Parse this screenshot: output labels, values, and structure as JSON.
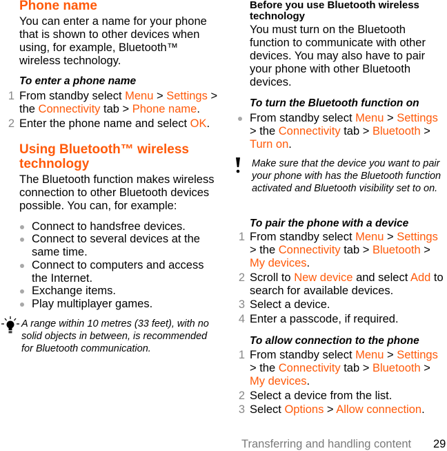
{
  "left": {
    "phone_name": {
      "heading": "Phone name",
      "paragraph": "You can enter a name for your phone that is shown to other devices when using, for example, Bluetooth™ wireless technology.",
      "subheading": "To enter a phone name",
      "steps": [
        {
          "num": "1",
          "parts": [
            "From standby select ",
            "Menu",
            " > ",
            "Settings",
            " > the ",
            "Connectivity",
            " tab > ",
            "Phone name",
            "."
          ]
        },
        {
          "num": "2",
          "parts": [
            "Enter the phone name and select ",
            "OK",
            "."
          ]
        }
      ]
    },
    "bluetooth": {
      "heading": "Using Bluetooth™ wireless technology",
      "paragraph": "The Bluetooth function makes wireless connection to other Bluetooth devices possible. You can, for example:",
      "bullets": [
        "Connect to handsfree devices.",
        "Connect to several devices at the same time.",
        "Connect to computers and access the Internet.",
        "Exchange items.",
        "Play multiplayer games."
      ],
      "tip_icon": "lightbulb-icon",
      "tip": "A range within 10 metres (33 feet), with no solid objects in between, is recommended for Bluetooth communication."
    }
  },
  "right": {
    "before": {
      "heading": "Before you use Bluetooth wireless technology",
      "paragraph": "You must turn on the Bluetooth function to communicate with other devices. You may also have to pair your phone with other Bluetooth devices."
    },
    "turn_on": {
      "subheading": "To turn the Bluetooth function on",
      "parts": [
        "From standby select ",
        "Menu",
        " > ",
        "Settings",
        " > the ",
        "Connectivity",
        " tab > ",
        "Bluetooth",
        " > ",
        "Turn on",
        "."
      ]
    },
    "warning_icon": "exclamation-icon",
    "warning": "Make sure that the device you want to pair your phone with has the Bluetooth function activated and Bluetooth visibility set to on.",
    "pair": {
      "subheading": "To pair the phone with a device",
      "steps": [
        {
          "num": "1",
          "parts": [
            "From standby select ",
            "Menu",
            " > ",
            "Settings",
            " > the ",
            "Connectivity",
            " tab > ",
            "Bluetooth",
            " > ",
            "My devices",
            "."
          ]
        },
        {
          "num": "2",
          "parts": [
            "Scroll to ",
            "New device",
            " and select ",
            "Add",
            " to search for available devices."
          ]
        },
        {
          "num": "3",
          "parts": [
            "Select a device."
          ]
        },
        {
          "num": "4",
          "parts": [
            "Enter a passcode, if required."
          ]
        }
      ]
    },
    "allow": {
      "subheading": "To allow connection to the phone",
      "steps": [
        {
          "num": "1",
          "parts": [
            "From standby select ",
            "Menu",
            " > ",
            "Settings",
            " > the ",
            "Connectivity",
            " tab > ",
            "Bluetooth",
            " > ",
            "My devices",
            "."
          ]
        },
        {
          "num": "2",
          "parts": [
            "Select a device from the list."
          ]
        },
        {
          "num": "3",
          "parts": [
            "Select ",
            "Options",
            " > ",
            "Allow connection",
            "."
          ]
        }
      ]
    }
  },
  "footer": {
    "section_title": "Transferring and handling content",
    "page_number": "29"
  },
  "colors": {
    "accent": "#ff5a0a",
    "step_number": "#888888",
    "bullet": "#a8a8a8",
    "footer_text": "#7a7a7a"
  }
}
